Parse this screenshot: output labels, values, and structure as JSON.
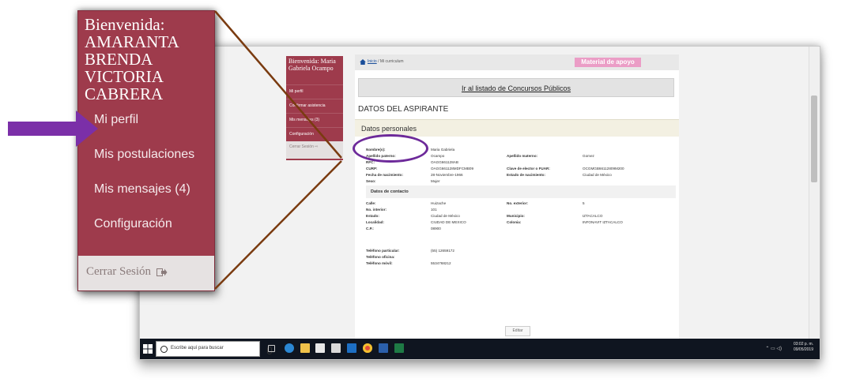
{
  "zoom_panel": {
    "welcome": "Bienvenida: AMARANTA BRENDA VICTORIA CABRERA",
    "items": [
      "Mi perfil",
      "Mis postulaciones",
      "Mis mensajes (4)",
      "Configuración"
    ],
    "logout": "Cerrar Sesión"
  },
  "mini_sidebar": {
    "welcome": "Bienvenida: Maria Gabriela Ocampo",
    "items": [
      "Mi perfil",
      "Confirmar asistencia",
      "Mis mensajes (3)",
      "Configuración"
    ],
    "logout": "Cerrar Sesión"
  },
  "breadcrumb": {
    "home": "Inicio",
    "sep": " / ",
    "current": "Mi curriculum"
  },
  "material_button": "Material de apoyo",
  "concursos_link": "Ir al listado de Concursos Públicos",
  "section_title": "DATOS DEL ASPIRANTE",
  "datos_header": "Datos personales",
  "personal": [
    [
      "Nombre(s):",
      "Maria Gabriela",
      "",
      ""
    ],
    [
      "Apellido paterno:",
      "Ocampo",
      "Apellido materno:",
      "Gomez"
    ],
    [
      "RFC:",
      "OAGG661128AB",
      "",
      ""
    ],
    [
      "CURP:",
      "OAGG661128MDFCMB09",
      "Clave de elector o FUAR:",
      "OCGMGB66112809M200"
    ],
    [
      "Fecha de nacimiento:",
      "28-Noviembre-1966",
      "Estado de nacimiento:",
      "Ciudad de México"
    ],
    [
      "Sexo:",
      "Mujer",
      "",
      ""
    ]
  ],
  "contact_heading": "Datos de contacto",
  "contact": [
    [
      "Calle:",
      "Huizache",
      "No. exterior:",
      "5"
    ],
    [
      "No. interior:",
      "101",
      "",
      ""
    ],
    [
      "Estado:",
      "Ciudad de México",
      "Municipio:",
      "IZTACALCO"
    ],
    [
      "Localidad:",
      "CIUDAD DE MEXICO",
      "Colonia:",
      "INFONAVIT IZTACALCO"
    ],
    [
      "C.P.:",
      "08900",
      "",
      ""
    ]
  ],
  "phones": [
    [
      "Teléfono particular:",
      "(55) 12659172"
    ],
    [
      "Teléfono oficina:",
      ""
    ],
    [
      "Teléfono móvil:",
      "5534768212"
    ]
  ],
  "edit_button": "Editar",
  "taskbar": {
    "search_placeholder": "Escribe aquí para buscar",
    "time": "03:02 p. m.",
    "date": "09/05/2019"
  },
  "colors": {
    "sidebar": "#9e3b4c",
    "arrow": "#7b2fa8",
    "connector": "#7a3b10",
    "highlight": "#6d2a9a",
    "material_button": "#eb9dc6"
  }
}
